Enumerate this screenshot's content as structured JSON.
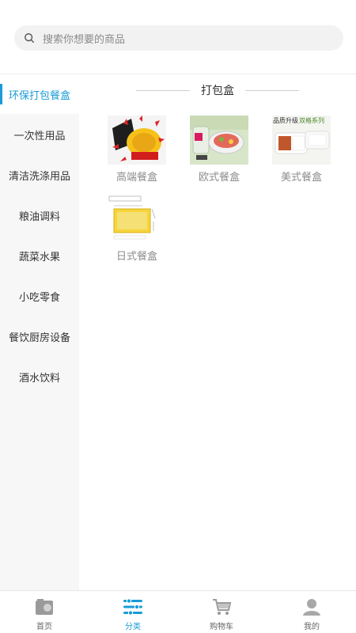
{
  "search": {
    "placeholder": "搜索你想要的商品"
  },
  "sidebar": {
    "items": [
      {
        "label": "环保打包餐盒",
        "active": true
      },
      {
        "label": "一次性用品"
      },
      {
        "label": "清洁洗涤用品"
      },
      {
        "label": "粮油调料"
      },
      {
        "label": "蔬菜水果"
      },
      {
        "label": "小吃零食"
      },
      {
        "label": "餐饮厨房设备"
      },
      {
        "label": "酒水饮料"
      }
    ]
  },
  "section": {
    "title": "打包盒"
  },
  "products": [
    {
      "name": "高端餐盒"
    },
    {
      "name": "欧式餐盒"
    },
    {
      "name": "美式餐盒",
      "image_text": {
        "left": "品质升级",
        "right": "双格系列"
      }
    },
    {
      "name": "日式餐盒"
    }
  ],
  "tabbar": {
    "items": [
      {
        "label": "首页"
      },
      {
        "label": "分类",
        "active": true
      },
      {
        "label": "购物车"
      },
      {
        "label": "我的"
      }
    ]
  },
  "colors": {
    "accent": "#1a9bd7",
    "muted": "#8c8c8c"
  }
}
